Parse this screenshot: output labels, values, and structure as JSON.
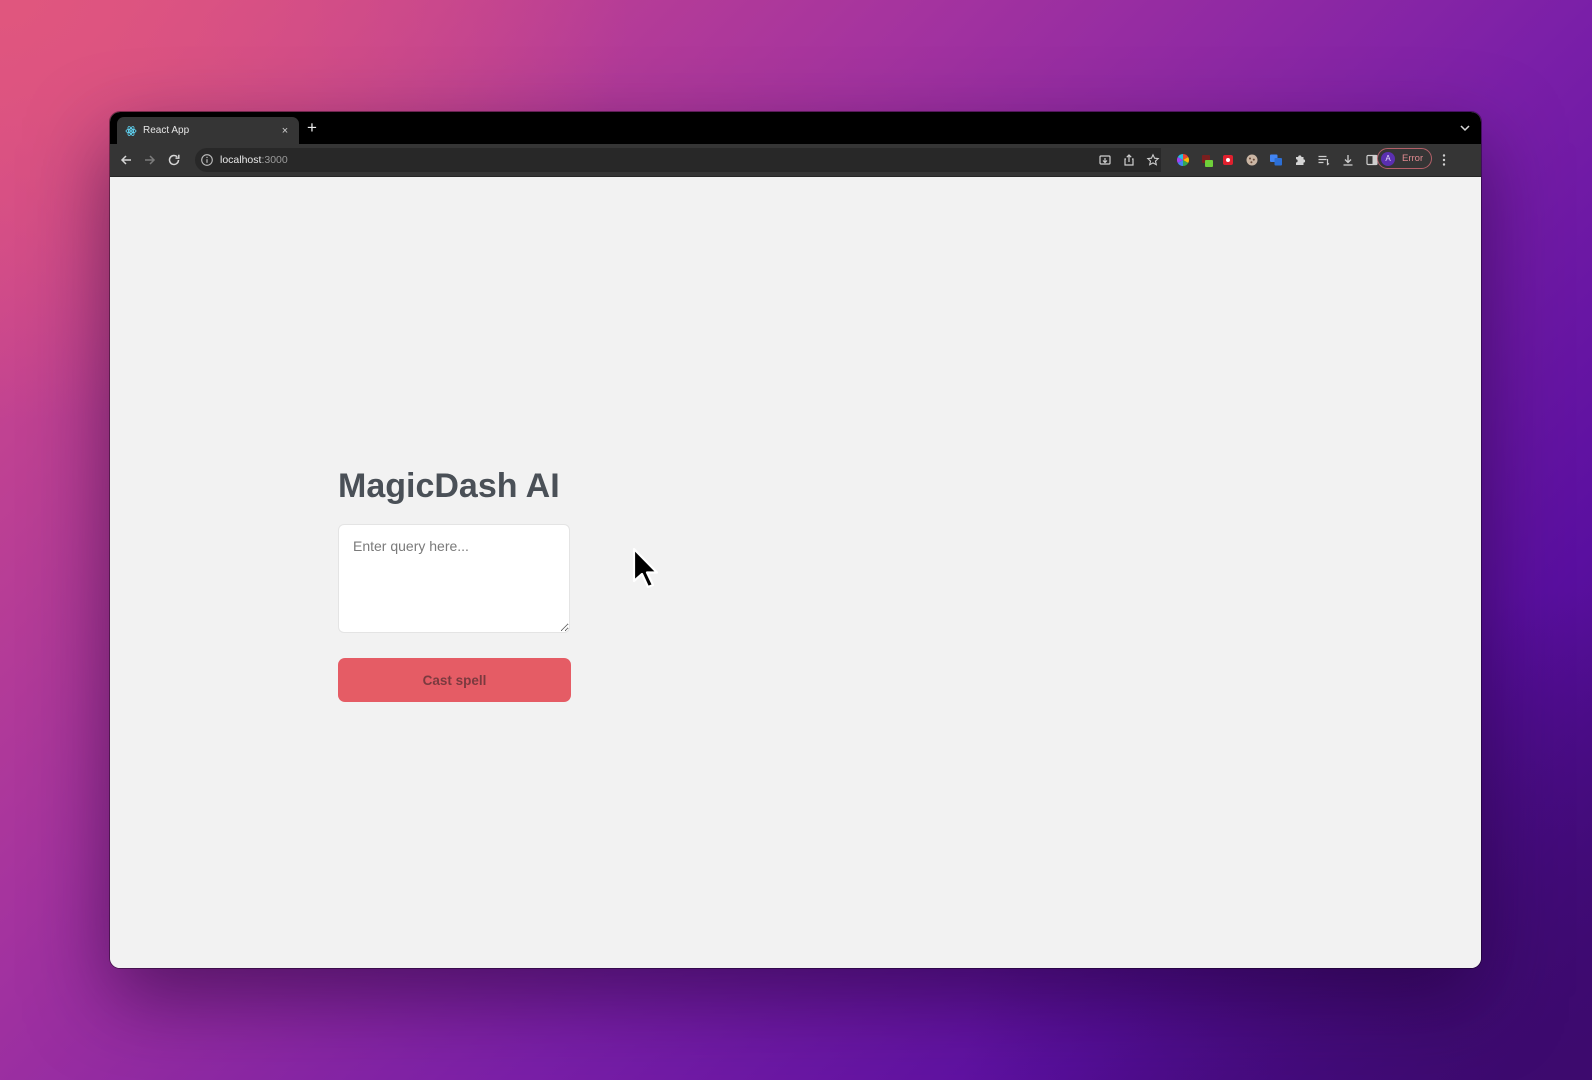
{
  "browser": {
    "tab": {
      "title": "React App",
      "favicon": "react-icon",
      "close_symbol": "×"
    },
    "new_tab_symbol": "+",
    "address_bar": {
      "host": "localhost",
      "port": ":3000"
    },
    "profile": {
      "avatar_initial": "A",
      "status": "Error"
    },
    "toolbar_icons": [
      "install-icon",
      "share-icon",
      "bookmark-star-icon",
      "color-wheel-extension-icon",
      "green-extension-icon",
      "red-extension-icon",
      "cookie-extension-icon",
      "translate-extension-icon",
      "puzzle-extensions-icon",
      "reading-list-icon",
      "download-icon",
      "side-panel-icon"
    ]
  },
  "app": {
    "title": "MagicDash AI",
    "query_placeholder": "Enter query here...",
    "query_value": "",
    "submit_label": "Cast spell"
  },
  "colors": {
    "button_background": "#e55c65",
    "button_text": "#7b3a3f",
    "title_text": "#4a5057",
    "page_background": "#f2f2f2"
  }
}
